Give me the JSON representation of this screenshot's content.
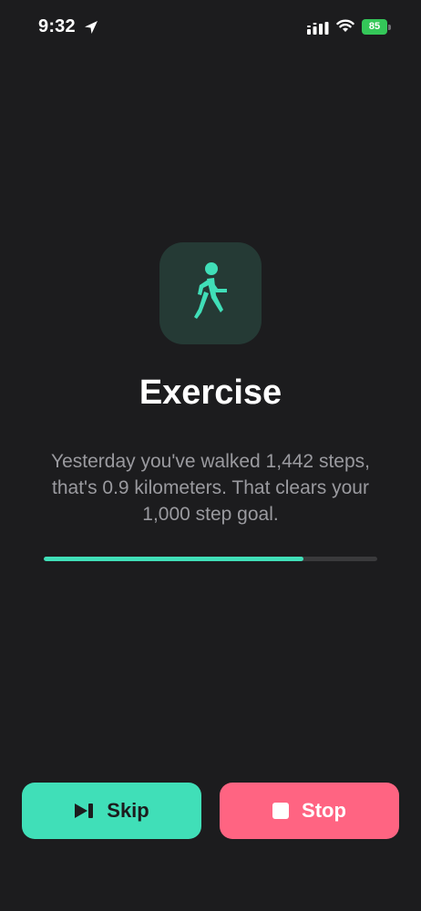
{
  "status_bar": {
    "time": "9:32",
    "battery_level": "85"
  },
  "main": {
    "icon": "walking-figure-icon",
    "title": "Exercise",
    "description": "Yesterday you've walked 1,442 steps, that's 0.9 kilometers. That clears your 1,000 step goal.",
    "progress_percent": 78
  },
  "actions": {
    "skip_label": "Skip",
    "stop_label": "Stop"
  },
  "colors": {
    "background": "#1c1c1e",
    "accent": "#40dfb8",
    "stop": "#ff6482",
    "battery": "#34c759"
  }
}
